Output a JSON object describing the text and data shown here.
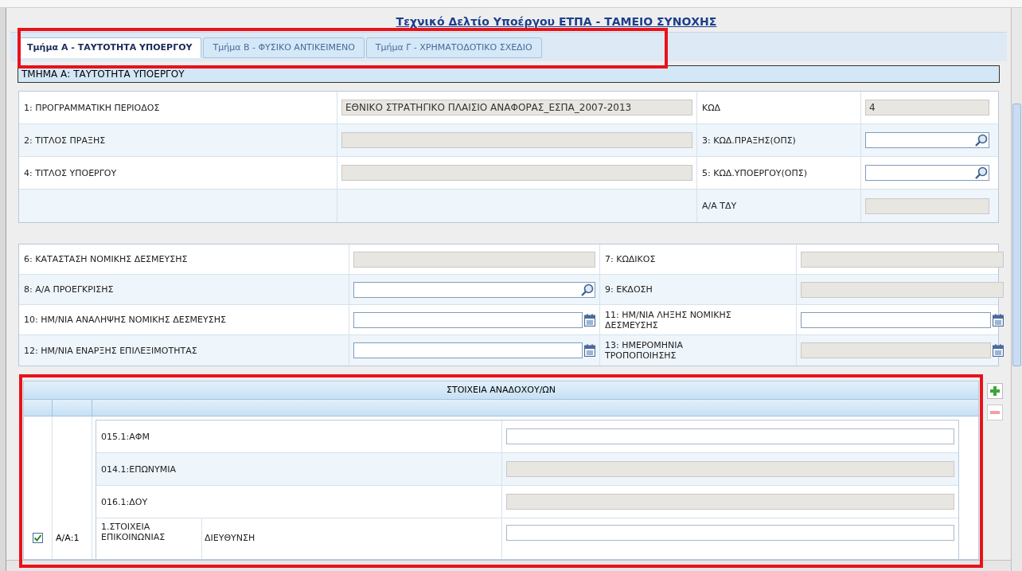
{
  "title": "Τεχνικό Δελτίο Υποέργου ΕΤΠΑ - ΤΑΜΕΙΟ ΣΥΝΟΧΗΣ",
  "tabs": [
    {
      "label": "Τμήμα Α - ΤΑΥΤΟΤΗΤΑ ΥΠΟΕΡΓΟΥ",
      "selected": true
    },
    {
      "label": "Τμήμα Β - ΦΥΣΙΚΟ ΑΝΤΙΚΕΙΜΕΝΟ",
      "selected": false
    },
    {
      "label": "Τμήμα Γ - ΧΡΗΜΑΤΟΔΟΤΙΚΟ ΣΧΕΔΙΟ",
      "selected": false
    }
  ],
  "section_header": "ΤΜΗΜΑ Α: ΤΑΥΤΟΤΗΤΑ ΥΠΟΕΡΓΟΥ",
  "identity_rows": [
    {
      "label": "1: ΠΡΟΓΡΑΜΜΑΤΙΚΗ ΠΕΡΙΟΔΟΣ",
      "field": {
        "kind": "disabled",
        "value": "ΕΘΝΙΚΟ ΣΤΡΑΤΗΓΙΚΟ ΠΛΑΙΣΙΟ ΑΝΑΦΟΡΑΣ_ΕΣΠΑ_2007-2013"
      },
      "label2": "ΚΩΔ",
      "field2": {
        "kind": "disabled",
        "value": "4"
      }
    },
    {
      "label": "2: ΤΙΤΛΟΣ ΠΡΑΞΗΣ",
      "field": {
        "kind": "disabled"
      },
      "label2": "3: ΚΩΔ.ΠΡΑΞΗΣ(ΟΠΣ)",
      "field2": {
        "kind": "lookup"
      }
    },
    {
      "label": "4: ΤΙΤΛΟΣ ΥΠΟΕΡΓΟΥ",
      "field": {
        "kind": "disabled"
      },
      "label2": "5: ΚΩΔ.ΥΠΟΕΡΓΟΥ(ΟΠΣ)",
      "field2": {
        "kind": "lookup"
      }
    },
    {
      "label2": "Α/Α ΤΔΥ",
      "field2": {
        "kind": "disabled"
      }
    }
  ],
  "commitment_rows": [
    {
      "label": "6: ΚΑΤΑΣΤΑΣΗ ΝΟΜΙΚΗΣ ΔΕΣΜΕΥΣΗΣ",
      "field": {
        "kind": "disabled"
      },
      "label2": "7: ΚΩΔΙΚΟΣ",
      "field2": {
        "kind": "disabled"
      }
    },
    {
      "label": "8: Α/Α ΠΡΟΕΓΚΡΙΣΗΣ",
      "field": {
        "kind": "lookup"
      },
      "label2": "9: ΕΚΔΟΣΗ",
      "field2": {
        "kind": "disabled"
      }
    },
    {
      "label": "10: ΗΜ/ΝΙΑ ΑΝΑΛΗΨΗΣ ΝΟΜΙΚΗΣ ΔΕΣΜΕΥΣΗΣ",
      "field": {
        "kind": "date"
      },
      "label2": "11: ΗΜ/ΝΙΑ ΛΗΞΗΣ ΝΟΜΙΚΗΣ ΔΕΣΜΕΥΣΗΣ",
      "field2": {
        "kind": "date"
      }
    },
    {
      "label": "12: ΗΜ/ΝΙΑ ΕΝΑΡΞΗΣ ΕΠΙΛΕΞΙΜΟΤΗΤΑΣ",
      "field": {
        "kind": "date"
      },
      "label2": "13: ΗΜΕΡΟΜΗΝΙΑ ΤΡΟΠΟΠΟΙΗΣΗΣ",
      "field2": {
        "kind": "date_disabled"
      }
    }
  ],
  "contractors": {
    "title": "ΣΤΟΙΧΕΙΑ ΑΝΑΔΟΧΟΥ/ΩΝ",
    "rows": [
      {
        "checked": true,
        "number": "Α/Α:1",
        "fields": [
          {
            "label": "015.1:ΑΦΜ",
            "field": {
              "kind": "text"
            }
          },
          {
            "label": "014.1:ΕΠΩΝΥΜΙΑ",
            "field": {
              "kind": "disabled"
            }
          },
          {
            "label": "016.1:ΔΟΥ",
            "field": {
              "kind": "disabled"
            }
          }
        ],
        "contact": {
          "label": "1.ΣΤΟΙΧΕΙΑ ΕΠΙΚΟΙΝΩΝΙΑΣ",
          "items": [
            {
              "label": "ΔΙΕΥΘΥΝΣΗ",
              "field": {
                "kind": "text"
              }
            }
          ]
        }
      }
    ]
  }
}
